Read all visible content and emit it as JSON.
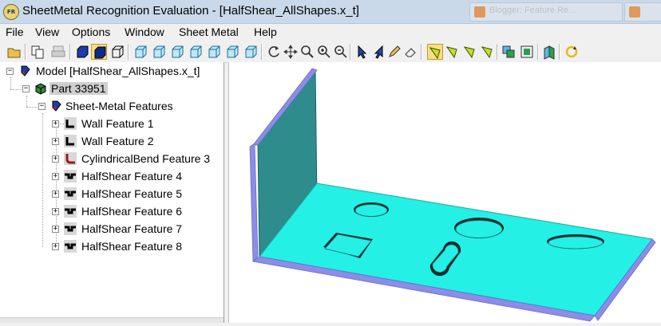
{
  "window": {
    "app_icon_text": "FR",
    "title": "SheetMetal Recognition Evaluation - [HalfShear_AllShapes.x_t]",
    "background_tabs": [
      "Blogger: Feature Re…",
      ""
    ]
  },
  "menu": [
    "File",
    "View",
    "Options",
    "Window",
    "Sheet Metal",
    "Help"
  ],
  "toolbar": {
    "buttons": [
      "open-icon",
      "copy-icon",
      "print-icon",
      "wireframe-box-icon",
      "shaded-box-icon",
      "hidden-line-box-icon",
      "front-view-icon",
      "back-view-icon",
      "left-view-icon",
      "right-view-icon",
      "top-view-icon",
      "bottom-view-icon",
      "iso-view-icon",
      "rotate-icon",
      "pan-icon",
      "zoom-icon",
      "zoom-in-icon",
      "zoom-out-icon",
      "select-arrow-icon",
      "select-back-icon",
      "pencil-icon",
      "eraser-icon",
      "select-face-icon",
      "select-edge-icon",
      "select-vertex-icon",
      "select-body-icon",
      "layers-icon",
      "fit-icon",
      "section-icon",
      "refresh-icon"
    ]
  },
  "tree": {
    "model": "Model [HalfShear_AllShapes.x_t]",
    "part": "Part 33951",
    "group": "Sheet-Metal Features",
    "features": [
      {
        "label": "Wall Feature 1",
        "icon": "wall-feature-icon"
      },
      {
        "label": "Wall Feature 2",
        "icon": "wall-feature-icon"
      },
      {
        "label": "CylindricalBend Feature 3",
        "icon": "bend-feature-icon"
      },
      {
        "label": "HalfShear Feature 4",
        "icon": "halfshear-feature-icon"
      },
      {
        "label": "HalfShear Feature 5",
        "icon": "halfshear-feature-icon"
      },
      {
        "label": "HalfShear Feature 6",
        "icon": "halfshear-feature-icon"
      },
      {
        "label": "HalfShear Feature 7",
        "icon": "halfshear-feature-icon"
      },
      {
        "label": "HalfShear Feature 8",
        "icon": "halfshear-feature-icon"
      }
    ]
  },
  "colors": {
    "part_face": "#24f0e6",
    "part_edge": "#8b8de6",
    "wall_face": "#2e8c8c",
    "titlebar": "#c9d9ea",
    "highlight": "#f7dd84"
  }
}
